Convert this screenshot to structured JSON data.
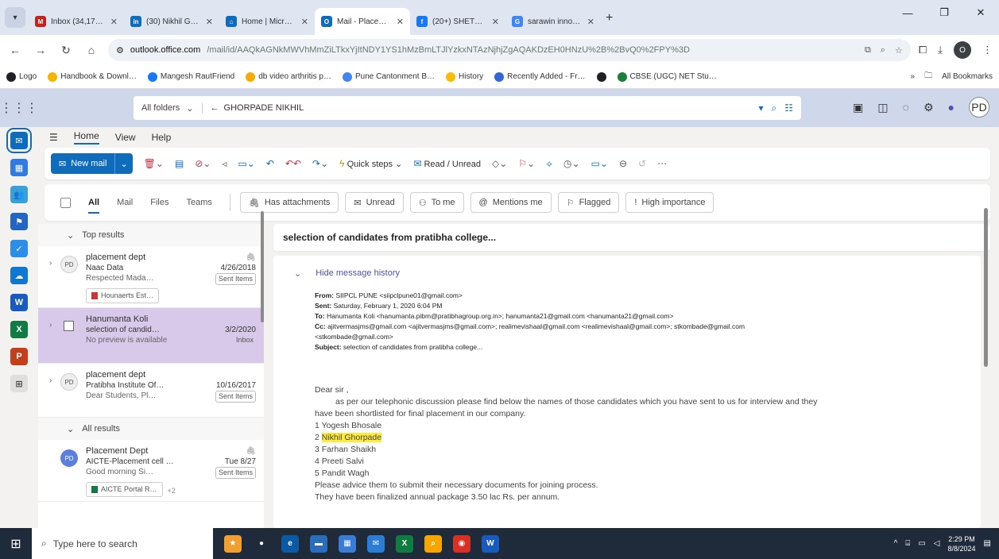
{
  "browser": {
    "tabs": [
      {
        "title": "Inbox (34,170) - har…",
        "color": "#c5221f",
        "glyph": "M",
        "active": false
      },
      {
        "title": "(30) Nikhil Ghorpad…",
        "color": "#0f6cbd",
        "glyph": "in",
        "active": false
      },
      {
        "title": "Home | Microsoft 365",
        "color": "#0f6cbd",
        "glyph": "⌂",
        "active": false
      },
      {
        "title": "Mail - Placement D…",
        "color": "#0f6cbd",
        "glyph": "O",
        "active": true
      },
      {
        "title": "(20+) SHETTY ANUP",
        "color": "#1877f2",
        "glyph": "f",
        "active": false
      },
      {
        "title": "sarawin innovation",
        "color": "#4285f4",
        "glyph": "G",
        "active": false
      }
    ],
    "url_host": "outlook.office.com",
    "url_path": "/mail/id/AAQkAGNkMWVhMmZiLTkxYjItNDY1YS1hMzBmLTJlYzkxNTAzNjhjZgAQAKDzEH0HNzU%2B%2BvQ0%2FPY%3D",
    "bookmarks": [
      {
        "label": "Logo",
        "color": "#202124"
      },
      {
        "label": "Handbook & Downl…",
        "color": "#f4b400"
      },
      {
        "label": "Mangesh RautFriend",
        "color": "#1877f2"
      },
      {
        "label": "db video arthritis p…",
        "color": "#f9ab00"
      },
      {
        "label": "Pune Cantonment B…",
        "color": "#4285f4"
      },
      {
        "label": "History",
        "color": "#fbbc04"
      },
      {
        "label": "Recently Added - Fr…",
        "color": "#3367d6"
      },
      {
        "label": "",
        "color": "#202124"
      },
      {
        "label": "CBSE (UGC) NET Stu…",
        "color": "#188038"
      }
    ],
    "all_bookmarks": "All Bookmarks",
    "profile_initial": "O"
  },
  "outlook": {
    "search_scope": "All folders",
    "search_tag": "GHORPADE NIKHIL",
    "user_initials": "PD",
    "ribbon_tabs": [
      "Home",
      "View",
      "Help"
    ],
    "new_mail": "New mail",
    "quick_steps": "Quick steps",
    "read_unread": "Read / Unread",
    "filter_tabs": [
      "All",
      "Mail",
      "Files",
      "Teams"
    ],
    "filter_chips": [
      "Has attachments",
      "Unread",
      "To me",
      "Mentions me",
      "Flagged",
      "High importance"
    ]
  },
  "list": {
    "top_results": "Top results",
    "all_results": "All results",
    "items": [
      {
        "initials": "PD",
        "from": "placement dept",
        "subject": "Naac Data",
        "date": "4/26/2018",
        "preview": "Respected Mada…",
        "folder": "Sent Items",
        "attachment": "Hounaerts Est…"
      },
      {
        "initials": "",
        "from": "Hanumanta Koli",
        "subject": "selection of candid…",
        "date": "3/2/2020",
        "preview": "No preview is available",
        "folder": "Inbox",
        "attachment": ""
      },
      {
        "initials": "PD",
        "from": "placement dept",
        "subject": "Pratibha Institute Of…",
        "date": "10/16/2017",
        "preview": "Dear Students, Pl…",
        "folder": "Sent Items",
        "attachment": ""
      },
      {
        "initials": "PD",
        "from": "Placement Dept",
        "subject": "AICTE-Placement cell …",
        "date": "Tue 8/27",
        "preview": "Good morning Si…",
        "folder": "Sent Items",
        "attachment": "AICTE Portal R…",
        "extra": "+2"
      }
    ]
  },
  "reading": {
    "subject": "selection of candidates from pratibha college...",
    "hide_history": "Hide message history",
    "from_label": "From:",
    "from": "SIIPCL PUNE <siipclpune01@gmail.com>",
    "sent_label": "Sent:",
    "sent": "Saturday, February 1, 2020 6:04 PM",
    "to_label": "To:",
    "to": "Hanumanta Koli <hanumanta.pibm@pratibhagroup.org.in>; hanumanta21@gmail.com <hanumanta21@gmail.com>",
    "cc_label": "Cc:",
    "cc": "ajitvermasjms@gmail.com <ajitvermasjms@gmail.com>; realimevishaal@gmail.com <realimevishaal@gmail.com>; stkombade@gmail.com",
    "cc2": "<stkombade@gmail.com>",
    "subject_label": "Subject:",
    "subject_line": "selection of candidates from pratibha college...",
    "greeting": "Dear sir ,",
    "para1": "as per our telephonic discussion please find below the names of those candidates      which you have sent to us for interview and they",
    "para2": "have been shortlisted for final placement in our company.",
    "c1": "1 Yogesh Bhosale",
    "c2_prefix": "2 ",
    "c2_name": "Nikhil Ghorpade",
    "c3": "3 Farhan Shaikh",
    "c4": "4 Preeti  Salvi",
    "c5": "5 Pandit Wagh",
    "advice": "Please advice  them to submit their necessary documents for joining process.",
    "package": "They have been finalized  annual package  3.50 lac Rs. per annum."
  },
  "taskbar": {
    "search_placeholder": "Type here to search",
    "time": "2:29 PM",
    "date": "8/8/2024"
  }
}
